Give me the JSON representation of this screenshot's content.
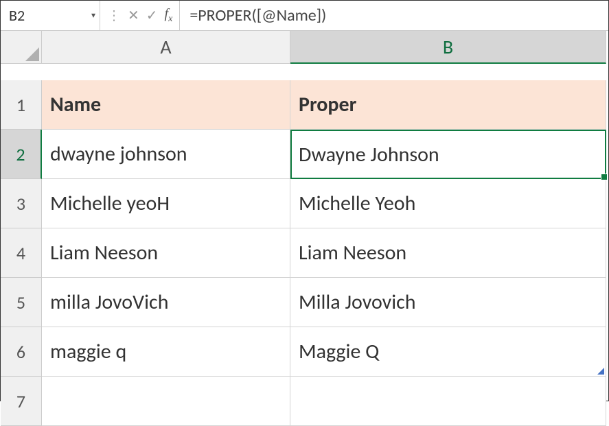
{
  "formula_bar": {
    "cell_ref": "B2",
    "fx_label": "fx",
    "formula": "=PROPER([@Name])"
  },
  "columns": {
    "A": "A",
    "B": "B"
  },
  "row_labels": [
    "1",
    "2",
    "3",
    "4",
    "5",
    "6",
    "7"
  ],
  "table": {
    "headers": {
      "A": "Name",
      "B": "Proper"
    },
    "rows": [
      {
        "A": "dwayne johnson",
        "B": "Dwayne Johnson"
      },
      {
        "A": "Michelle yeoH",
        "B": "Michelle Yeoh"
      },
      {
        "A": "Liam Neeson",
        "B": "Liam Neeson"
      },
      {
        "A": "milla JovoVich",
        "B": "Milla Jovovich"
      },
      {
        "A": "maggie q",
        "B": "Maggie Q"
      }
    ]
  },
  "selected_cell": "B2"
}
